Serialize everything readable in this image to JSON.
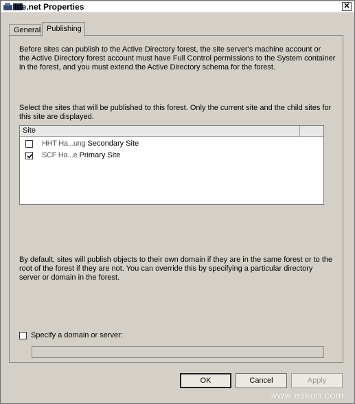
{
  "window": {
    "title": "life.net Properties",
    "close_glyph": "✕"
  },
  "tabs": [
    {
      "label": "General",
      "active": false
    },
    {
      "label": "Publishing",
      "active": true
    }
  ],
  "publishing": {
    "intro_lines": [
      "Before sites can publish to the Active Directory forest, the site server's machine account or",
      "the Active Directory forest account must have Full Control permissions to the System container",
      "in the forest, and you must extend the Active Directory schema for the forest."
    ],
    "select_lines": [
      "Select the sites that will be published to this forest. Only the current site and the child sites for",
      "this site are displayed."
    ],
    "site_list": {
      "column_header": "Site",
      "rows": [
        {
          "redacted_prefix": "HHT Ha...ung",
          "label": "Secondary Site",
          "checked": false
        },
        {
          "redacted_prefix": "SCF Ha...e",
          "label": "Primary Site",
          "checked": true
        }
      ]
    },
    "default_lines": [
      "By default, sites will publish objects to their own domain if they are in the same forest or to the",
      "root of the forest if they are not.  You can override this by specifying a particular directory",
      "server or domain in the forest."
    ],
    "specify_checkbox": {
      "label": "Specify a domain or server:",
      "checked": false
    },
    "domain_field": {
      "value": ""
    }
  },
  "buttons": {
    "ok": "OK",
    "cancel": "Cancel",
    "apply": "Apply"
  },
  "watermark": "www.eskon.com"
}
